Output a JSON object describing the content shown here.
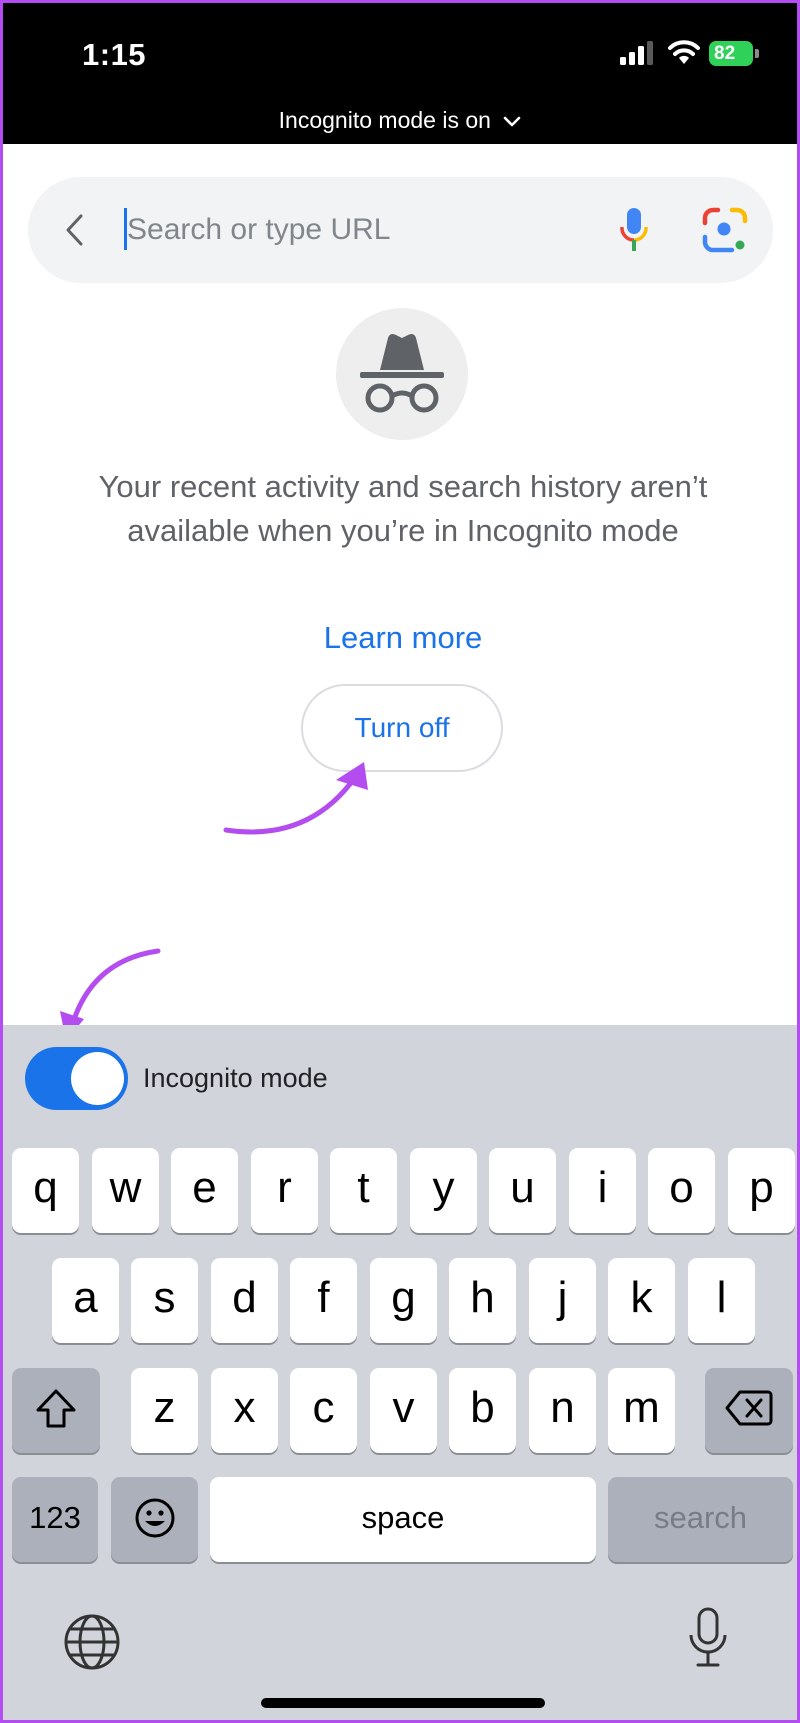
{
  "status_bar": {
    "time": "1:15",
    "battery": "82",
    "incognito_banner": "Incognito mode is on"
  },
  "search": {
    "placeholder": "Search or type URL"
  },
  "incognito_panel": {
    "message": "Your recent activity and search history aren’t available when you’re in Incognito mode",
    "learn_more": "Learn more",
    "turn_off": "Turn off"
  },
  "incognito_toggle": {
    "label": "Incognito mode",
    "on": true
  },
  "keyboard": {
    "row1": [
      "q",
      "w",
      "e",
      "r",
      "t",
      "y",
      "u",
      "i",
      "o",
      "p"
    ],
    "row2": [
      "a",
      "s",
      "d",
      "f",
      "g",
      "h",
      "j",
      "k",
      "l"
    ],
    "row3": [
      "z",
      "x",
      "c",
      "v",
      "b",
      "n",
      "m"
    ],
    "numbers_key": "123",
    "space_key": "space",
    "search_key": "search"
  },
  "colors": {
    "accent": "#1a73e8",
    "annotation_arrow": "#b34df0",
    "keyboard_bg": "#d1d4db"
  },
  "icons": [
    "back-chevron-icon",
    "microphone-icon",
    "google-lens-icon",
    "incognito-icon",
    "shift-icon",
    "backspace-icon",
    "emoji-icon",
    "globe-icon",
    "dictation-mic-icon"
  ]
}
